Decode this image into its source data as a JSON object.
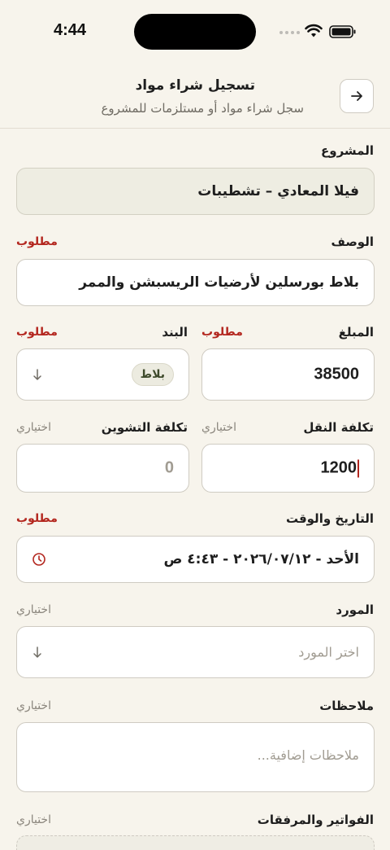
{
  "status": {
    "time": "4:44"
  },
  "header": {
    "title": "تسجيل شراء مواد",
    "subtitle": "سجل شراء مواد أو مستلزمات للمشروع"
  },
  "form": {
    "project": {
      "label": "المشروع",
      "value": "فيلا المعادي – تشطيبات"
    },
    "description": {
      "label": "الوصف",
      "required": "مطلوب",
      "value": "بلاط بورسلين لأرضيات الريسبشن والممر"
    },
    "amount": {
      "label": "المبلغ",
      "required": "مطلوب",
      "value": "38500"
    },
    "item": {
      "label": "البند",
      "required": "مطلوب",
      "chip": "بلاط"
    },
    "transport": {
      "label": "تكلفة النقل",
      "optional": "اختياري",
      "value": "1200"
    },
    "storage": {
      "label": "تكلفة التشوين",
      "optional": "اختياري",
      "placeholder": "0"
    },
    "datetime": {
      "label": "التاريخ والوقت",
      "required": "مطلوب",
      "value": "الأحد - ٢٠٢٦/٠٧/١٢ - ٤:٤٣ ص"
    },
    "supplier": {
      "label": "المورد",
      "optional": "اختياري",
      "placeholder": "اختر المورد"
    },
    "notes": {
      "label": "ملاحظات",
      "optional": "اختياري",
      "placeholder": "ملاحظات إضافية..."
    },
    "attachments": {
      "label": "الفواتير والمرفقات",
      "optional": "اختياري"
    }
  },
  "colors": {
    "background": "#F7F4EC",
    "required": "#B3261E",
    "readonly_field": "#EEEDE2"
  }
}
